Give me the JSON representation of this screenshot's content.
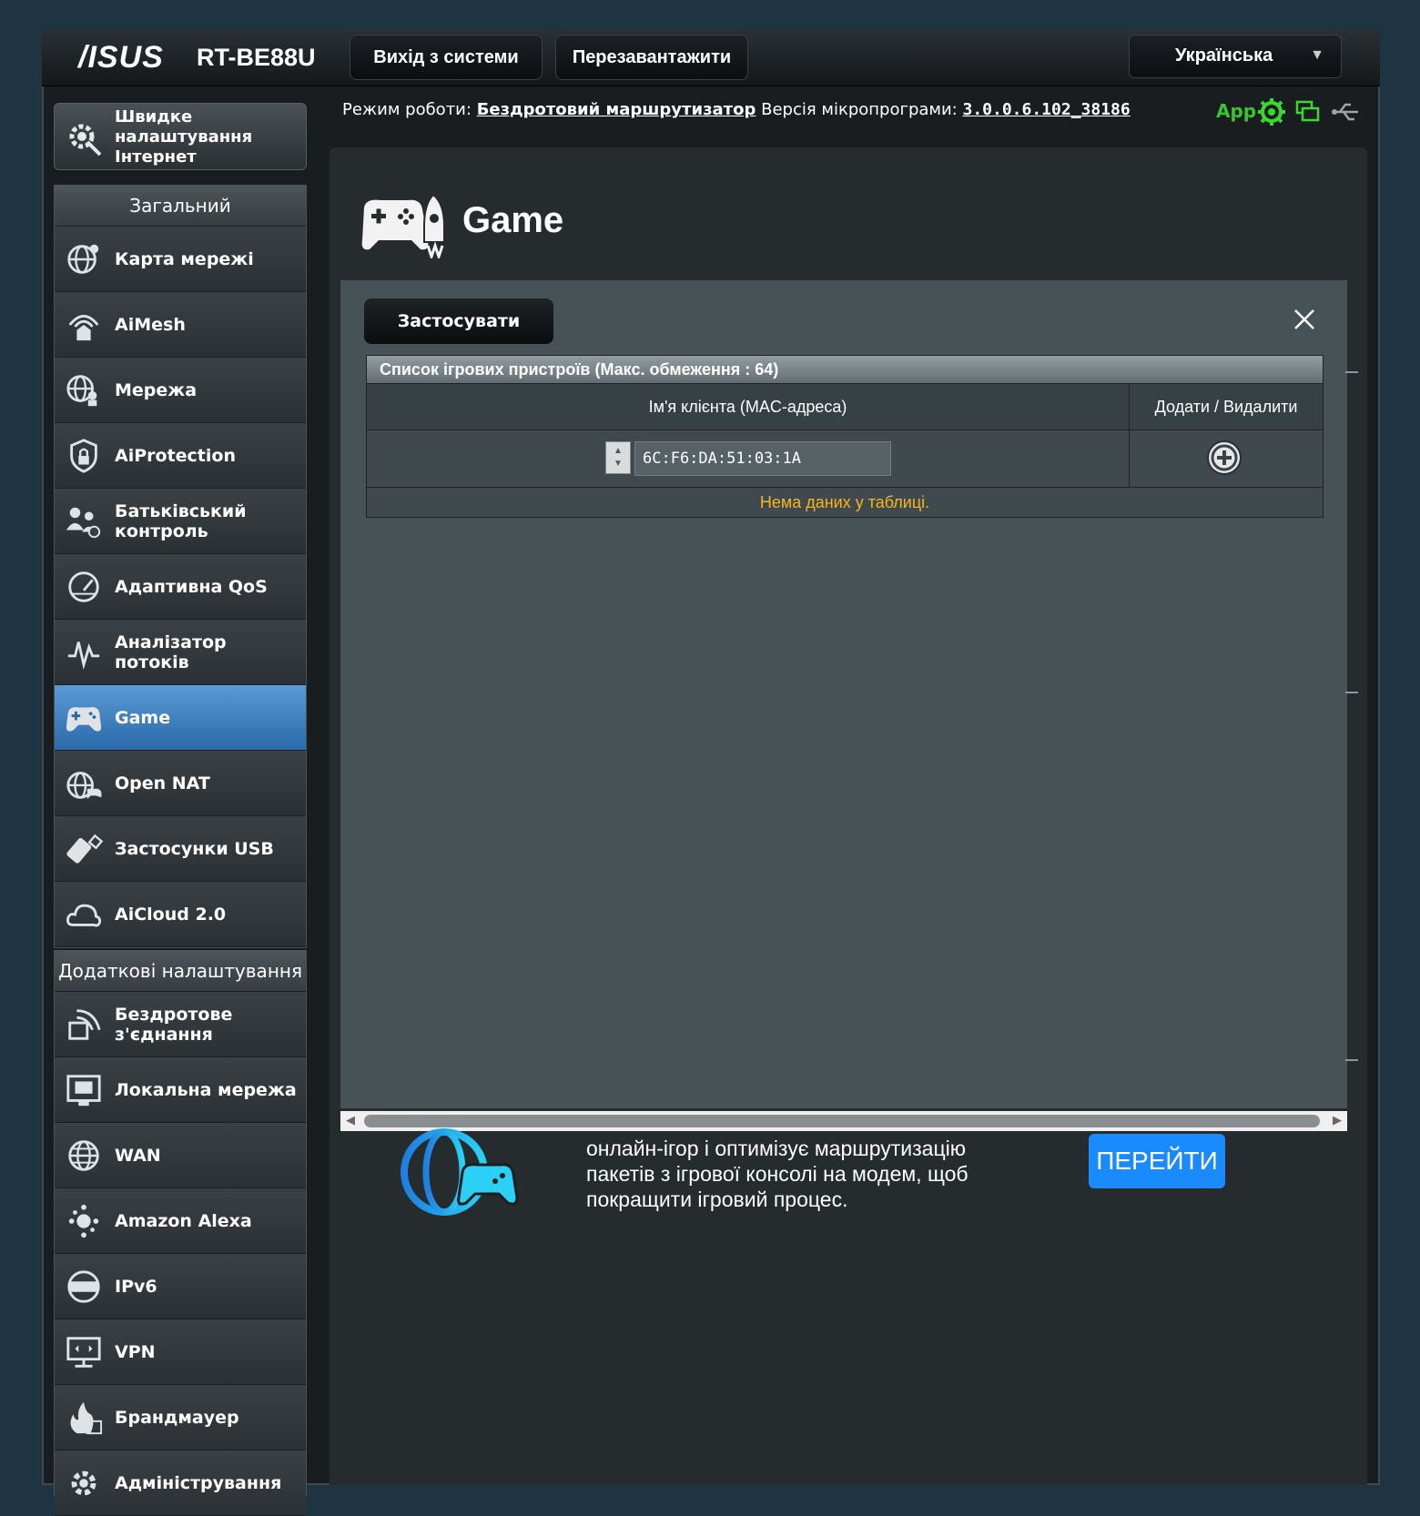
{
  "header": {
    "logo": "/ISUS",
    "model": "RT-BE88U",
    "logout_label": "Вихід з системи",
    "reboot_label": "Перезавантажити",
    "language": "Українська"
  },
  "status": {
    "mode_label": "Режим роботи:",
    "mode_value": "Бездротовий маршрутизатор",
    "fw_label": "Версія мікропрограми:",
    "fw_value": "3.0.0.6.102_38186",
    "app_label": "App"
  },
  "sidebar": {
    "quick_setup": "Швидке налаштування Інтернет",
    "general_title": "Загальний",
    "general_items": [
      {
        "label": "Карта мережі",
        "icon": "network-map-icon"
      },
      {
        "label": "AiMesh",
        "icon": "aimesh-icon"
      },
      {
        "label": "Мережа",
        "icon": "guest-network-icon"
      },
      {
        "label": "AiProtection",
        "icon": "shield-lock-icon"
      },
      {
        "label": "Батьківський контроль",
        "icon": "parental-control-icon"
      },
      {
        "label": "Адаптивна QoS",
        "icon": "speedometer-icon"
      },
      {
        "label": "Аналізатор потоків",
        "icon": "traffic-analyzer-icon"
      },
      {
        "label": "Game",
        "icon": "gamepad-icon"
      },
      {
        "label": "Open NAT",
        "icon": "open-nat-icon"
      },
      {
        "label": "Застосунки USB",
        "icon": "usb-icon"
      },
      {
        "label": "AiCloud 2.0",
        "icon": "cloud-icon"
      }
    ],
    "advanced_title": "Додаткові налаштування",
    "advanced_items": [
      {
        "label": "Бездротове з'єднання",
        "icon": "wireless-icon"
      },
      {
        "label": "Локальна мережа",
        "icon": "lan-icon"
      },
      {
        "label": "WAN",
        "icon": "globe-icon"
      },
      {
        "label": "Amazon Alexa",
        "icon": "alexa-icon"
      },
      {
        "label": "IPv6",
        "icon": "ipv6-icon"
      },
      {
        "label": "VPN",
        "icon": "vpn-icon"
      },
      {
        "label": "Брандмауер",
        "icon": "firewall-icon"
      },
      {
        "label": "Адміністрування",
        "icon": "gear-icon"
      }
    ]
  },
  "page": {
    "title": "Game",
    "apply_label": "Застосувати",
    "table_title": "Список ігрових пристроїв (Макс. обмеження : 64)",
    "col_client": "Ім'я клієнта (MAC-адреса)",
    "col_action": "Додати / Видалити",
    "mac_value": "6C:F6:DA:51:03:1A",
    "empty_text": "Нема даних у таблиці.",
    "promo_text": "онлайн-ігор і оптимізує маршрутизацію пакетів з ігрової консолі на модем, щоб покращити ігровий процес.",
    "goto_label": "ПЕРЕЙТИ"
  }
}
